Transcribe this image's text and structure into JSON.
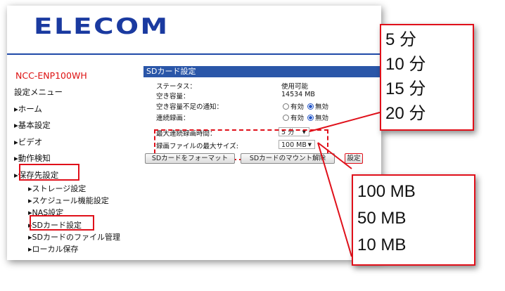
{
  "brand": "ELECOM",
  "model": "NCC-ENP100WH",
  "sidebar": {
    "items": [
      {
        "label": "設定メニュー"
      },
      {
        "label": "▸ホーム"
      },
      {
        "label": "▸基本設定"
      },
      {
        "label": "▸ビデオ"
      },
      {
        "label": "▸動作検知"
      },
      {
        "label": "▸保存先設定"
      }
    ],
    "sub_items": [
      {
        "label": "▸ストレージ設定"
      },
      {
        "label": "▸スケジュール機能設定"
      },
      {
        "label": "▸NAS設定"
      },
      {
        "label": "▸SDカード設定"
      },
      {
        "label": "▸SDカードのファイル管理"
      },
      {
        "label": "▸ローカル保存"
      }
    ]
  },
  "panel": {
    "title": "SDカード設定",
    "status_label": "ステータス：",
    "status_value": "使用可能",
    "free_label": "空き容量：",
    "free_value": "14534 MB",
    "notify_label": "空き容量不足の通知：",
    "notify_on": "有効",
    "notify_off": "無効",
    "cont_label": "連続録画：",
    "cont_on": "有効",
    "cont_off": "無効",
    "max_time_label": "最大連続録画時間：",
    "max_time_value": "5 分",
    "max_size_label": "録画ファイルの最大サイズ:",
    "max_size_value": "100 MB",
    "format_button": "SDカードをフォーマット",
    "unmount_button": "SDカードのマウント解除",
    "apply_button": "設定"
  },
  "callout_time": [
    "5 分",
    "10 分",
    "15 分",
    "20 分"
  ],
  "callout_size": [
    "100 MB",
    "50 MB",
    "10 MB"
  ],
  "colors": {
    "accent": "#2a56a8",
    "highlight": "#e0101a",
    "brand": "#1a3aa0"
  }
}
